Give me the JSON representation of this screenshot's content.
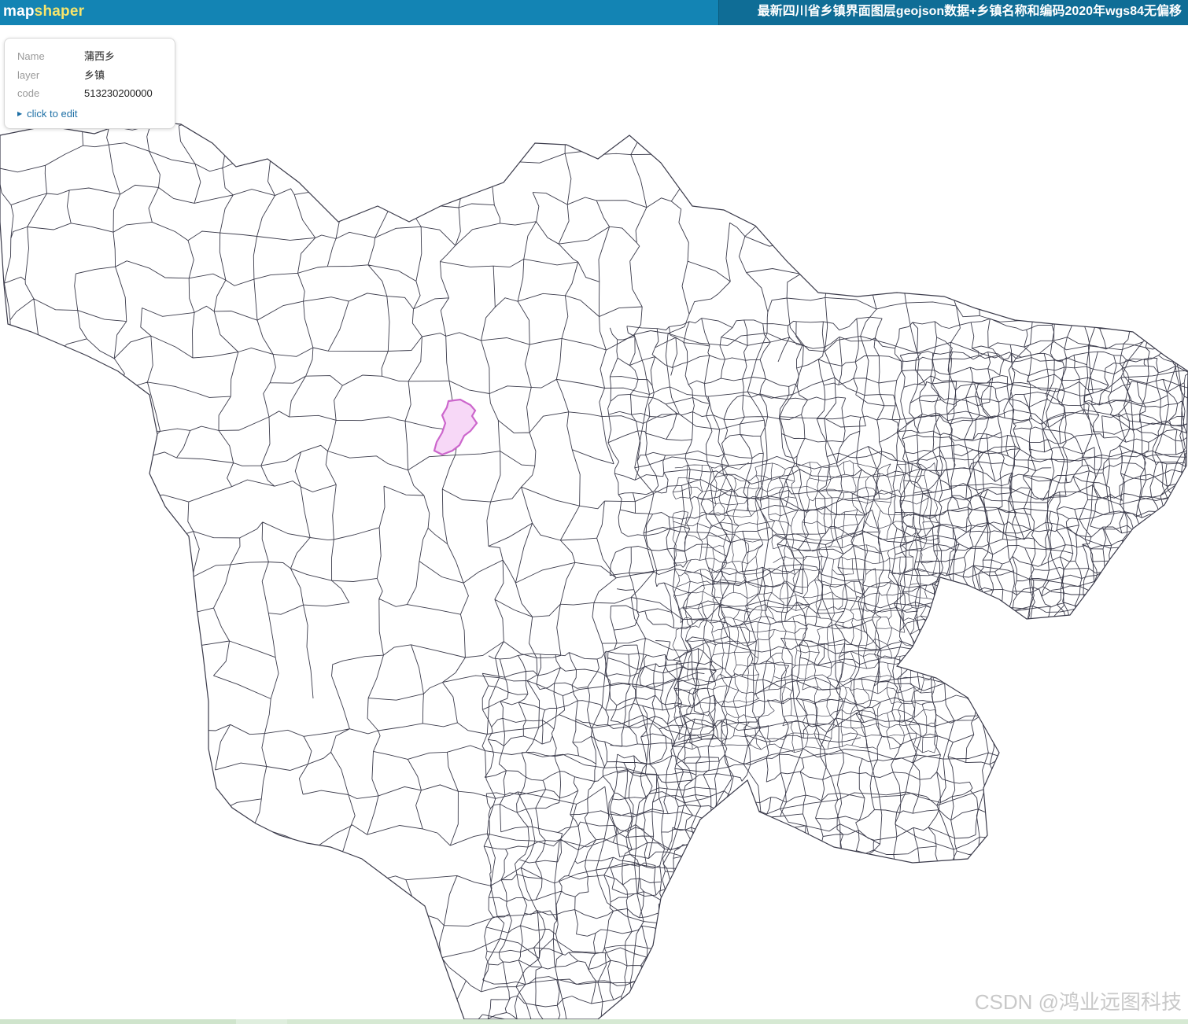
{
  "header": {
    "logo_main": "map",
    "logo_accent": "shaper",
    "title": "最新四川省乡镇界面图层geojson数据+乡镇名称和编码2020年wgs84无偏移"
  },
  "popup": {
    "rows": [
      {
        "key": "Name",
        "value": "蒲西乡"
      },
      {
        "key": "layer",
        "value": "乡镇"
      },
      {
        "key": "code",
        "value": "513230200000"
      }
    ],
    "edit_label": "click to edit"
  },
  "map": {
    "line_color": "#3a3a4a",
    "highlight_fill": "#f7d8f7",
    "highlight_stroke": "#cc66cc"
  },
  "watermark": "CSDN @鸿业远图科技"
}
